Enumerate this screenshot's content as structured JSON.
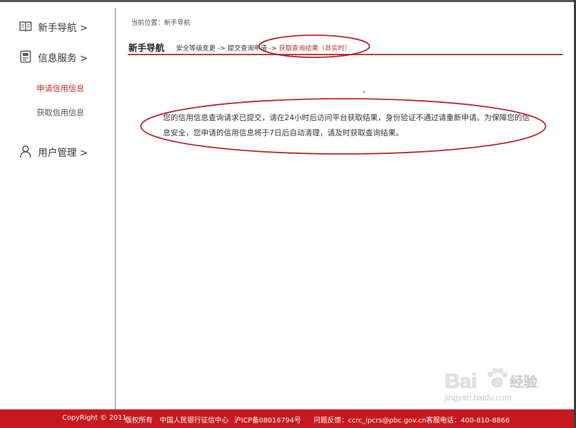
{
  "sidebar": {
    "items": [
      {
        "label": "新手导航 >",
        "icon": "book-icon"
      },
      {
        "label": "信息服务 >",
        "icon": "document-icon"
      },
      {
        "label": "用户管理 >",
        "icon": "user-icon"
      }
    ],
    "sub_items": [
      {
        "label": "申请信用信息",
        "active": true
      },
      {
        "label": "获取信用信息",
        "active": false
      }
    ]
  },
  "breadcrumb": "当前位置：新手导航",
  "nav": {
    "title": "新手导航",
    "step1": "安全等级变更 ->",
    "step2": "提交查询申请 ->",
    "step3": "获取查询结果（非实时）"
  },
  "dot": "。",
  "message": "您的信用信息查询请求已提交，请在24小时后访问平台获取结果，身份验证不通过请重新申请。为保障您的信息安全，您申请的信用信息将于7日后自动清理，请及时获取查询结果。",
  "footer": {
    "copyright": "CopyRight © 2011",
    "rights": "版权所有",
    "org": "中国人民银行征信中心",
    "icp": "沪ICP备08016794号",
    "feedback": "问题反馈：ccrc_ipcrs@pbc.gov.cn",
    "hotline": "客服电话：400-810-8866"
  },
  "watermark": {
    "text": "Bai",
    "text2": "经验",
    "url": "jingyan.baidu.com"
  },
  "colors": {
    "accent": "#b5322b",
    "footer_bg": "#c8181f",
    "annotation": "#b01e24"
  }
}
